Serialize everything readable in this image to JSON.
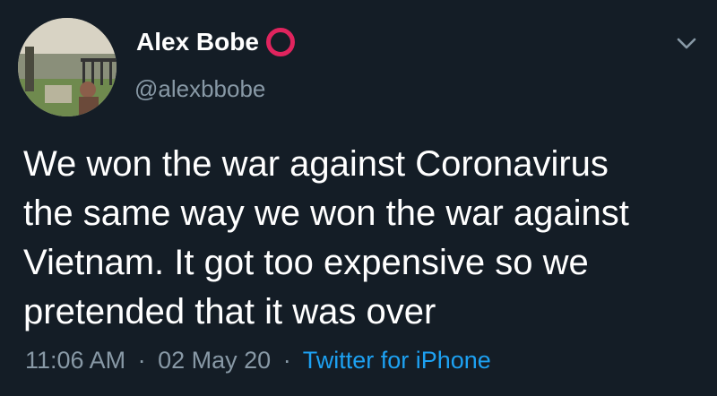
{
  "user": {
    "display_name": "Alex Bobe",
    "handle": "@alexbbobe",
    "badge_color": "#e0245e",
    "avatar_icon": "profile-photo"
  },
  "tweet": {
    "text": "We won the war against Coronavirus\nthe same way we won the war against\nVietnam. It got too expensive so we\npretended that it was over",
    "time": "11:06 AM",
    "separator": "·",
    "date": "02 May 20",
    "source": "Twitter for iPhone"
  },
  "menu": {
    "icon": "chevron-down-icon"
  },
  "colors": {
    "background": "#141d26",
    "text": "#ffffff",
    "secondary_text": "#8899a6",
    "link": "#1da1f2"
  }
}
